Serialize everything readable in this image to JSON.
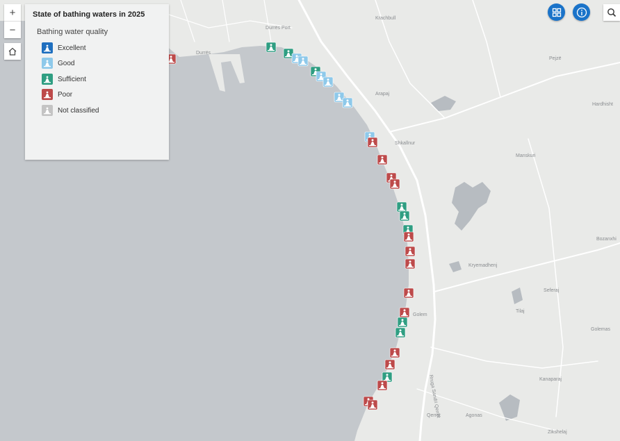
{
  "controls": {
    "zoom_in_label": "+",
    "zoom_out_label": "−"
  },
  "legend": {
    "title": "State of bathing waters in 2025",
    "subtitle": "Bathing water quality",
    "items": [
      {
        "label": "Excellent",
        "color": "#1f6fbf"
      },
      {
        "label": "Good",
        "color": "#8ec9ea"
      },
      {
        "label": "Sufficient",
        "color": "#2f9e82"
      },
      {
        "label": "Poor",
        "color": "#bd4a4a"
      },
      {
        "label": "Not classified",
        "color": "#c4c4c4"
      }
    ]
  },
  "map": {
    "colors": {
      "water": "#c4c8cc",
      "land": "#e9eae8",
      "road": "#ffffff",
      "lake": "#b7bcc1"
    },
    "place_names": [
      "Durrës",
      "Durrës Port",
      "Krachbull",
      "Arapaj",
      "Shkallnur",
      "Manskuri",
      "Pejzë",
      "Hardhisht",
      "Bozanxhi",
      "Kryemadhenj",
      "Seferaj",
      "Tilaj",
      "Golem",
      "Golemas",
      "Kanaparaj",
      "Qerret",
      "Agonas",
      "Zikshelaj",
      "Rruga Sandri Qerret"
    ]
  },
  "markers": [
    {
      "q": "good"
    },
    {
      "q": "poor"
    },
    {
      "q": "sufficient"
    },
    {
      "q": "sufficient"
    },
    {
      "q": "good"
    },
    {
      "q": "good"
    },
    {
      "q": "sufficient"
    },
    {
      "q": "good"
    },
    {
      "q": "good"
    },
    {
      "q": "good"
    },
    {
      "q": "good"
    },
    {
      "q": "good"
    },
    {
      "q": "poor"
    },
    {
      "q": "poor"
    },
    {
      "q": "poor"
    },
    {
      "q": "poor"
    },
    {
      "q": "sufficient"
    },
    {
      "q": "sufficient"
    },
    {
      "q": "sufficient"
    },
    {
      "q": "poor"
    },
    {
      "q": "poor"
    },
    {
      "q": "poor"
    },
    {
      "q": "poor"
    },
    {
      "q": "poor"
    },
    {
      "q": "sufficient"
    },
    {
      "q": "sufficient"
    },
    {
      "q": "poor"
    },
    {
      "q": "poor"
    },
    {
      "q": "sufficient"
    },
    {
      "q": "poor"
    },
    {
      "q": "poor"
    },
    {
      "q": "poor"
    }
  ]
}
